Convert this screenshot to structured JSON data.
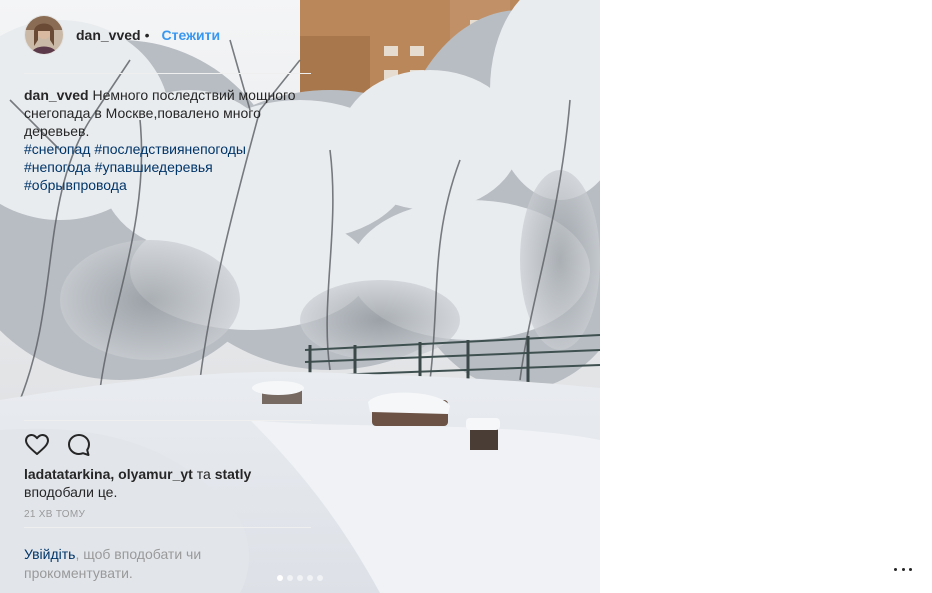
{
  "post": {
    "username": "dan_vved",
    "follow_separator": "•",
    "follow_label": "Стежити",
    "caption_user": "dan_vved",
    "caption_text": "Немного последствий мощного снегопада в Москве,повалено много деревьев.",
    "hashtags": [
      "#снегопад",
      "#последствиянепогоды",
      "#непогода",
      "#упавшиедеревья",
      "#обрывпровода"
    ],
    "liked_by": "ladatatarkina, olyamur_yt",
    "liked_and": "та",
    "liked_other": "statly",
    "liked_suffix": "вподобали це.",
    "time_ago": "21 хв тому",
    "login_link": "Увійдіть",
    "login_rest": ", щоб вподобати чи прокоментувати."
  },
  "carousel": {
    "count": 5,
    "active": 1
  },
  "icons": {
    "like": "heart-outline-icon",
    "comment": "comment-bubble-icon",
    "more": "more-options-icon"
  },
  "colors": {
    "link_blue": "#3897f0",
    "hashtag": "#003569",
    "muted": "#999999",
    "text": "#262626"
  }
}
